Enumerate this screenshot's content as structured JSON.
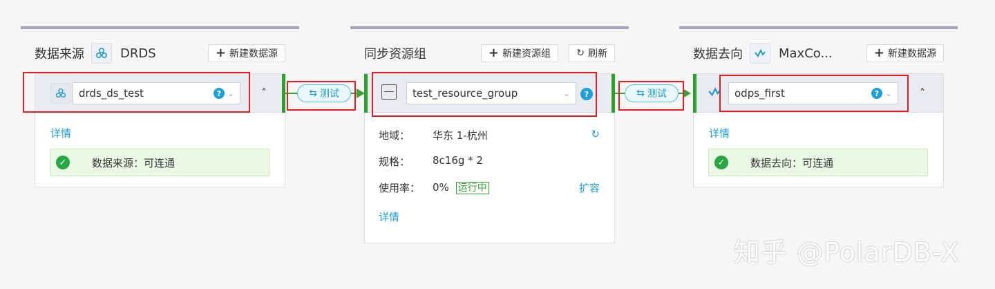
{
  "source": {
    "title": "数据来源",
    "type_name": "DRDS",
    "new_button": "新建数据源",
    "selected": "drds_ds_test",
    "details": "详情",
    "status": "数据来源：可连通"
  },
  "resource": {
    "title": "同步资源组",
    "new_button": "新建资源组",
    "refresh_button": "刷新",
    "selected": "test_resource_group",
    "region_label": "地域：",
    "region_value": "华东 1-杭州",
    "spec_label": "规格：",
    "spec_value": "8c16g * 2",
    "usage_label": "使用率：",
    "usage_value": "0%",
    "status": "运行中",
    "expand": "扩容",
    "details": "详情"
  },
  "target": {
    "title": "数据去向",
    "type_name": "MaxCo...",
    "new_button": "新建数据源",
    "selected": "odps_first",
    "details": "详情",
    "status": "数据去向：可连通"
  },
  "connectors": [
    {
      "label": "测试"
    },
    {
      "label": "测试"
    }
  ],
  "help_icon": "?",
  "watermark": "知乎 @PolarDB-X",
  "colors": {
    "accent": "#1f9ccf",
    "green": "#3aa13a",
    "highlight": "#e51c23",
    "topbar": "#a3a6b9"
  }
}
